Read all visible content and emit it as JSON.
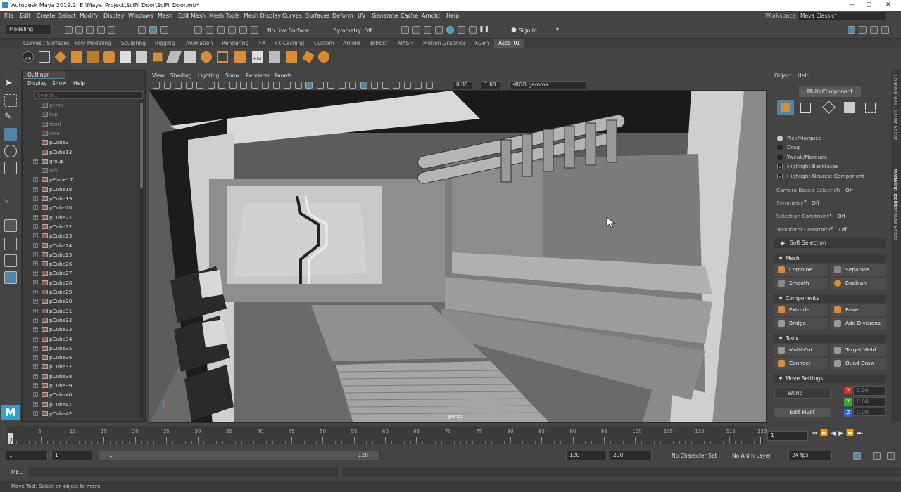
{
  "window": {
    "title": "Autodesk Maya 2019.2: E:\\Maya_Project\\SciFi_Door\\SciFi_Door.mb*",
    "minimize": "—",
    "maximize": "▢",
    "close": "✕"
  },
  "menus": [
    "File",
    "Edit",
    "Create",
    "Select",
    "Modify",
    "Display",
    "Windows",
    "Mesh",
    "Edit Mesh",
    "Mesh Tools",
    "Mesh Display",
    "Curves",
    "Surfaces",
    "Deform",
    "UV",
    "Generate",
    "Cache",
    "Arnold",
    "Help"
  ],
  "workspace": {
    "label": "Workspace :",
    "value": "Maya Classic*"
  },
  "status_line": {
    "menuset": "Modeling",
    "live_surface": "No Live Surface",
    "symmetry": "Symmetry: Off",
    "sign_in": "Sign In"
  },
  "shelf_tabs": [
    "Curves / Surfaces",
    "Poly Modeling",
    "Sculpting",
    "Rigging",
    "Animation",
    "Rendering",
    "FX",
    "FX Caching",
    "Custom",
    "Arnold",
    "Bifrost",
    "MASH",
    "Motion Graphics",
    "XGen",
    "Asco_01"
  ],
  "shelf_active": "Asco_01",
  "shelf_icons": {
    "cp": "CP",
    "hist": "Hist"
  },
  "outliner": {
    "title": "Outliner",
    "menus": [
      "Display",
      "Show",
      "Help"
    ],
    "search_placeholder": "Search...",
    "items": [
      {
        "name": "persp",
        "kind": "camera",
        "dim": true,
        "exp": false
      },
      {
        "name": "top",
        "kind": "camera",
        "dim": true,
        "exp": false
      },
      {
        "name": "front",
        "kind": "camera",
        "dim": true,
        "exp": false
      },
      {
        "name": "side",
        "kind": "camera",
        "dim": true,
        "exp": false
      },
      {
        "name": "pCube3",
        "kind": "mesh",
        "dim": false,
        "exp": false
      },
      {
        "name": "pCube13",
        "kind": "mesh",
        "dim": false,
        "exp": false
      },
      {
        "name": "group",
        "kind": "group",
        "dim": false,
        "exp": true
      },
      {
        "name": "left",
        "kind": "camera",
        "dim": true,
        "exp": false
      },
      {
        "name": "pPlane17",
        "kind": "mesh",
        "dim": false,
        "exp": true
      },
      {
        "name": "pCube18",
        "kind": "mesh",
        "dim": false,
        "exp": true
      },
      {
        "name": "pCube19",
        "kind": "mesh",
        "dim": false,
        "exp": true
      },
      {
        "name": "pCube20",
        "kind": "mesh",
        "dim": false,
        "exp": true
      },
      {
        "name": "pCube21",
        "kind": "mesh",
        "dim": false,
        "exp": true
      },
      {
        "name": "pCube22",
        "kind": "mesh",
        "dim": false,
        "exp": true
      },
      {
        "name": "pCube23",
        "kind": "mesh",
        "dim": false,
        "exp": true
      },
      {
        "name": "pCube24",
        "kind": "mesh",
        "dim": false,
        "exp": true
      },
      {
        "name": "pCube25",
        "kind": "mesh",
        "dim": false,
        "exp": true
      },
      {
        "name": "pCube26",
        "kind": "mesh",
        "dim": false,
        "exp": true
      },
      {
        "name": "pCube27",
        "kind": "mesh",
        "dim": false,
        "exp": true
      },
      {
        "name": "pCube28",
        "kind": "mesh",
        "dim": false,
        "exp": true
      },
      {
        "name": "pCube29",
        "kind": "mesh",
        "dim": false,
        "exp": true
      },
      {
        "name": "pCube30",
        "kind": "mesh",
        "dim": false,
        "exp": true
      },
      {
        "name": "pCube31",
        "kind": "mesh",
        "dim": false,
        "exp": true
      },
      {
        "name": "pCube32",
        "kind": "mesh",
        "dim": false,
        "exp": true
      },
      {
        "name": "pCube33",
        "kind": "mesh",
        "dim": false,
        "exp": true
      },
      {
        "name": "pCube34",
        "kind": "mesh",
        "dim": false,
        "exp": true
      },
      {
        "name": "pCube35",
        "kind": "mesh",
        "dim": false,
        "exp": true
      },
      {
        "name": "pCube36",
        "kind": "mesh",
        "dim": false,
        "exp": true
      },
      {
        "name": "pCube37",
        "kind": "mesh",
        "dim": false,
        "exp": true
      },
      {
        "name": "pCube38",
        "kind": "mesh",
        "dim": false,
        "exp": true
      },
      {
        "name": "pCube39",
        "kind": "mesh",
        "dim": false,
        "exp": true
      },
      {
        "name": "pCube40",
        "kind": "mesh",
        "dim": false,
        "exp": true
      },
      {
        "name": "pCube41",
        "kind": "mesh",
        "dim": false,
        "exp": true
      },
      {
        "name": "pCube42",
        "kind": "mesh",
        "dim": false,
        "exp": true
      }
    ]
  },
  "viewport": {
    "menus": [
      "View",
      "Shading",
      "Lighting",
      "Show",
      "Renderer",
      "Panels"
    ],
    "exposure": "0.00",
    "gamma": "1.00",
    "color_space": "sRGB gamma",
    "camera_label": "persp"
  },
  "modeling_toolkit": {
    "menus": [
      "Object",
      "Help"
    ],
    "mode": "Multi-Component",
    "options": [
      {
        "label": "Pick/Marquee",
        "type": "radio",
        "on": true
      },
      {
        "label": "Drag",
        "type": "radio",
        "on": false
      },
      {
        "label": "Tweak/Marquee",
        "type": "radio",
        "on": false
      },
      {
        "label": "Highlight Backfaces",
        "type": "check",
        "on": true
      },
      {
        "label": "Highlight Nearest Component",
        "type": "check",
        "on": true
      }
    ],
    "camera_based": {
      "label": "Camera Based Selection",
      "value": "Off"
    },
    "symmetry": {
      "label": "Symmetry",
      "value": "Off"
    },
    "selection_constraint": {
      "label": "Selection Constraint",
      "value": "Off"
    },
    "transform_constraint": {
      "label": "Transform Constraint",
      "value": "Off"
    },
    "soft_selection": "Soft Selection",
    "sections": {
      "mesh": "Mesh",
      "components": "Components",
      "tools": "Tools",
      "move_settings": "Move Settings"
    },
    "mesh_buttons": [
      "Combine",
      "Separate",
      "Smooth",
      "Boolean"
    ],
    "component_buttons": [
      "Extrude",
      "Bevel",
      "Bridge",
      "Add Divisions"
    ],
    "tool_buttons": [
      "Multi-Cut",
      "Target Weld",
      "Connect",
      "Quad Draw"
    ],
    "move": {
      "space": "World",
      "edit_pivot": "Edit Pivot",
      "x": "0.00",
      "y": "0.00",
      "z": "0.00",
      "xl": "X",
      "yl": "Y",
      "zl": "Z"
    }
  },
  "side_tabs": [
    "Channel Box / Layer Editor",
    "Modeling Toolkit",
    "Attribute Editor"
  ],
  "time_slider": {
    "ticks": [
      "5",
      "10",
      "15",
      "20",
      "25",
      "30",
      "35",
      "40",
      "45",
      "50",
      "55",
      "60",
      "65",
      "70",
      "75",
      "80",
      "85",
      "90",
      "95",
      "100",
      "105",
      "110",
      "115",
      "120"
    ],
    "current_frame": "1",
    "marker": "1"
  },
  "range_slider": {
    "start": "1",
    "playback_start": "1",
    "range_start": "1",
    "range_end": "120",
    "playback_end": "120",
    "end": "200",
    "character_set": "No Character Set",
    "anim_layer": "No Anim Layer",
    "fps": "24 fps"
  },
  "command_line": {
    "label": "MEL"
  },
  "help_line": "Move Tool: Select an object to move.",
  "colors": {
    "accent": "#5285a6",
    "orange": "#d98b35",
    "bg": "#444444",
    "panel": "#3c3c3c"
  }
}
